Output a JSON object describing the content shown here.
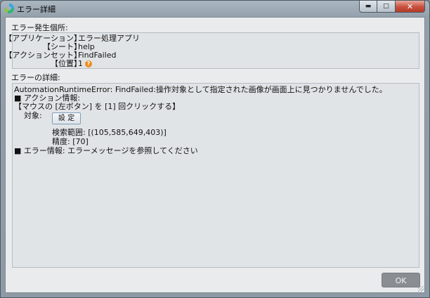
{
  "window": {
    "title": "エラー詳細",
    "icon": "app-logo-icon"
  },
  "titlebar_buttons": {
    "minimize": "▬",
    "maximize": "□",
    "close": "✕"
  },
  "location": {
    "label": "エラー発生個所:",
    "rows": [
      {
        "key": "【アプリケーション】",
        "value": "エラー処理アプリ"
      },
      {
        "key": "【シート】",
        "value": "help"
      },
      {
        "key": "【アクションセット】",
        "value": "FindFailed"
      },
      {
        "key": "【位置】",
        "value": "1"
      }
    ],
    "help_icon_glyph": "?"
  },
  "details": {
    "label": "エラーの詳細:",
    "error_line": "AutomationRuntimeError: FindFailed:操作対象として指定された画像が画面上に見つかりませんでした。",
    "action_header": "■ アクション情報:",
    "action_line": "【マウスの [左ボタン] を [1] 回クリックする】",
    "target_label": "対象:",
    "target_button": "設 定",
    "search_range": "検索範囲: [(105,585,649,403)]",
    "accuracy": "精度: [70]",
    "error_info": "■ エラー情報: エラーメッセージを参照してください"
  },
  "ok_button": "OK"
}
